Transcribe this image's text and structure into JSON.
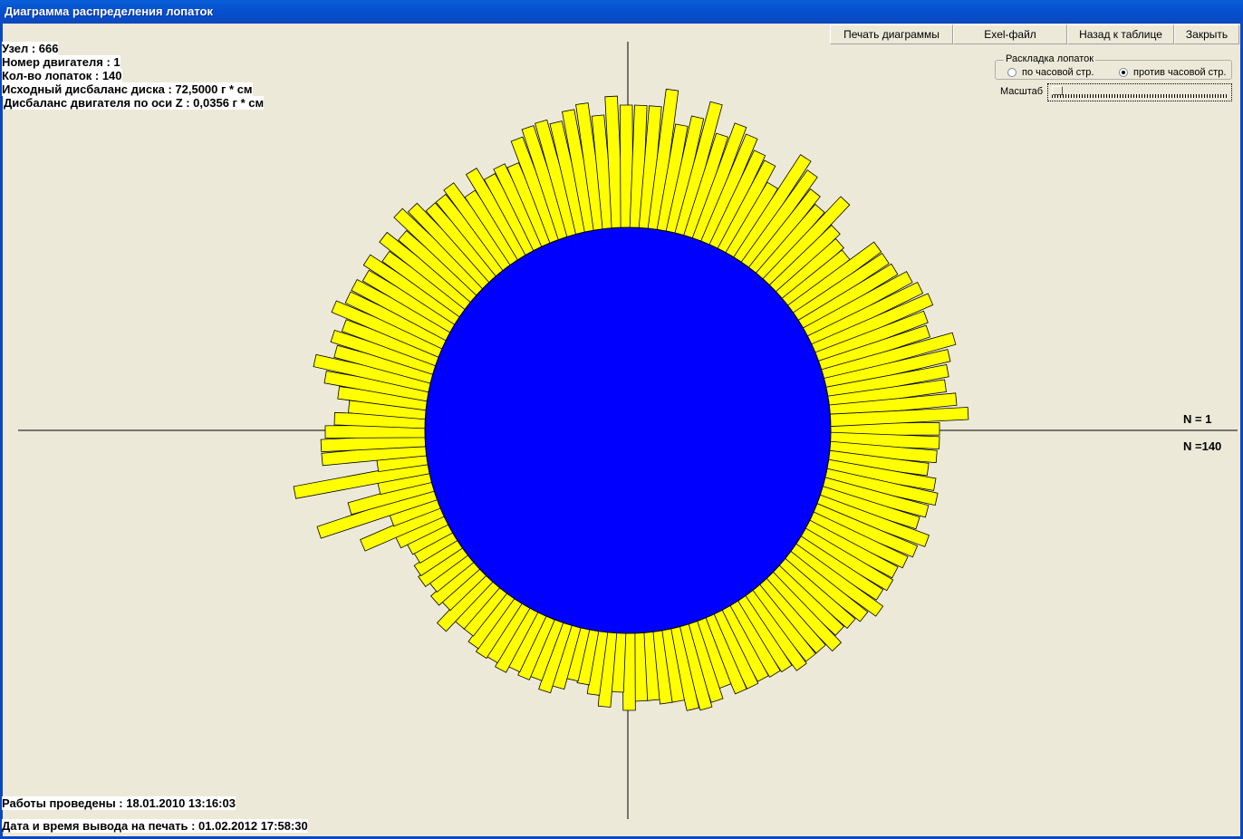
{
  "window": {
    "title": "Диаграмма распределения лопаток"
  },
  "toolbar": {
    "print_label": "Печать диаграммы",
    "excel_label": "Exel-файл",
    "back_label": "Назад к таблице",
    "close_label": "Закрыть"
  },
  "info": {
    "node": "Узел : 666",
    "engine": "Номер двигателя : 1",
    "blade_count": "Кол-во лопаток : 140",
    "disk_imbalance": "Исходный дисбаланс  диска : 72,5000  г * см",
    "engine_imbalance": "Дисбаланс двигателя по оси Z : 0,0356  г * см",
    "works_done": "Работы проведены : 18.01.2010 13:16:03",
    "print_time": "Дата и время вывода на печать : 01.02.2012 17:58:30"
  },
  "layout_group": {
    "title": "Раскладка лопаток",
    "clockwise_label": "по часовой стр.",
    "counter_label": "против часовой стр.",
    "selected": "counter"
  },
  "scale": {
    "label": "Масштаб",
    "value": 0
  },
  "markers": {
    "first": "N = 1",
    "last": "N =140"
  },
  "colors": {
    "hub": "#0000ff",
    "blade": "#ffff00",
    "outline": "#000000",
    "background": "#ece9d8"
  },
  "chart_data": {
    "type": "polar-bar",
    "blade_count": 140,
    "direction": "counter-clockwise",
    "start": "right",
    "values": [
      120,
      120,
      118,
      110,
      120,
      125,
      118,
      112,
      128,
      120,
      115,
      110,
      112,
      108,
      118,
      108,
      102,
      98,
      108,
      98,
      98,
      100,
      92,
      90,
      88,
      90,
      90,
      78,
      90,
      95,
      92,
      80,
      80,
      75,
      75,
      85,
      65,
      82,
      70,
      60,
      58,
      70,
      78,
      68,
      72,
      68,
      75,
      70,
      72,
      68,
      60,
      60,
      75,
      55,
      60,
      52,
      58,
      55,
      48,
      50,
      58,
      95,
      55,
      135,
      95,
      58,
      150,
      55,
      115,
      115,
      110,
      100,
      85,
      98,
      115,
      130,
      110,
      118,
      110,
      128,
      118,
      118,
      112,
      120,
      105,
      120,
      105,
      125,
      118,
      105,
      105,
      110,
      90,
      110,
      95,
      100,
      95,
      120,
      128,
      130,
      125,
      135,
      140,
      125,
      145,
      135,
      135,
      135,
      155,
      118,
      130,
      150,
      118,
      135,
      128,
      115,
      110,
      90,
      135,
      125,
      110,
      100,
      125,
      95,
      88,
      85,
      118,
      118,
      120,
      130,
      135,
      140,
      128,
      125,
      150,
      140,
      135,
      130,
      140,
      152
    ]
  }
}
